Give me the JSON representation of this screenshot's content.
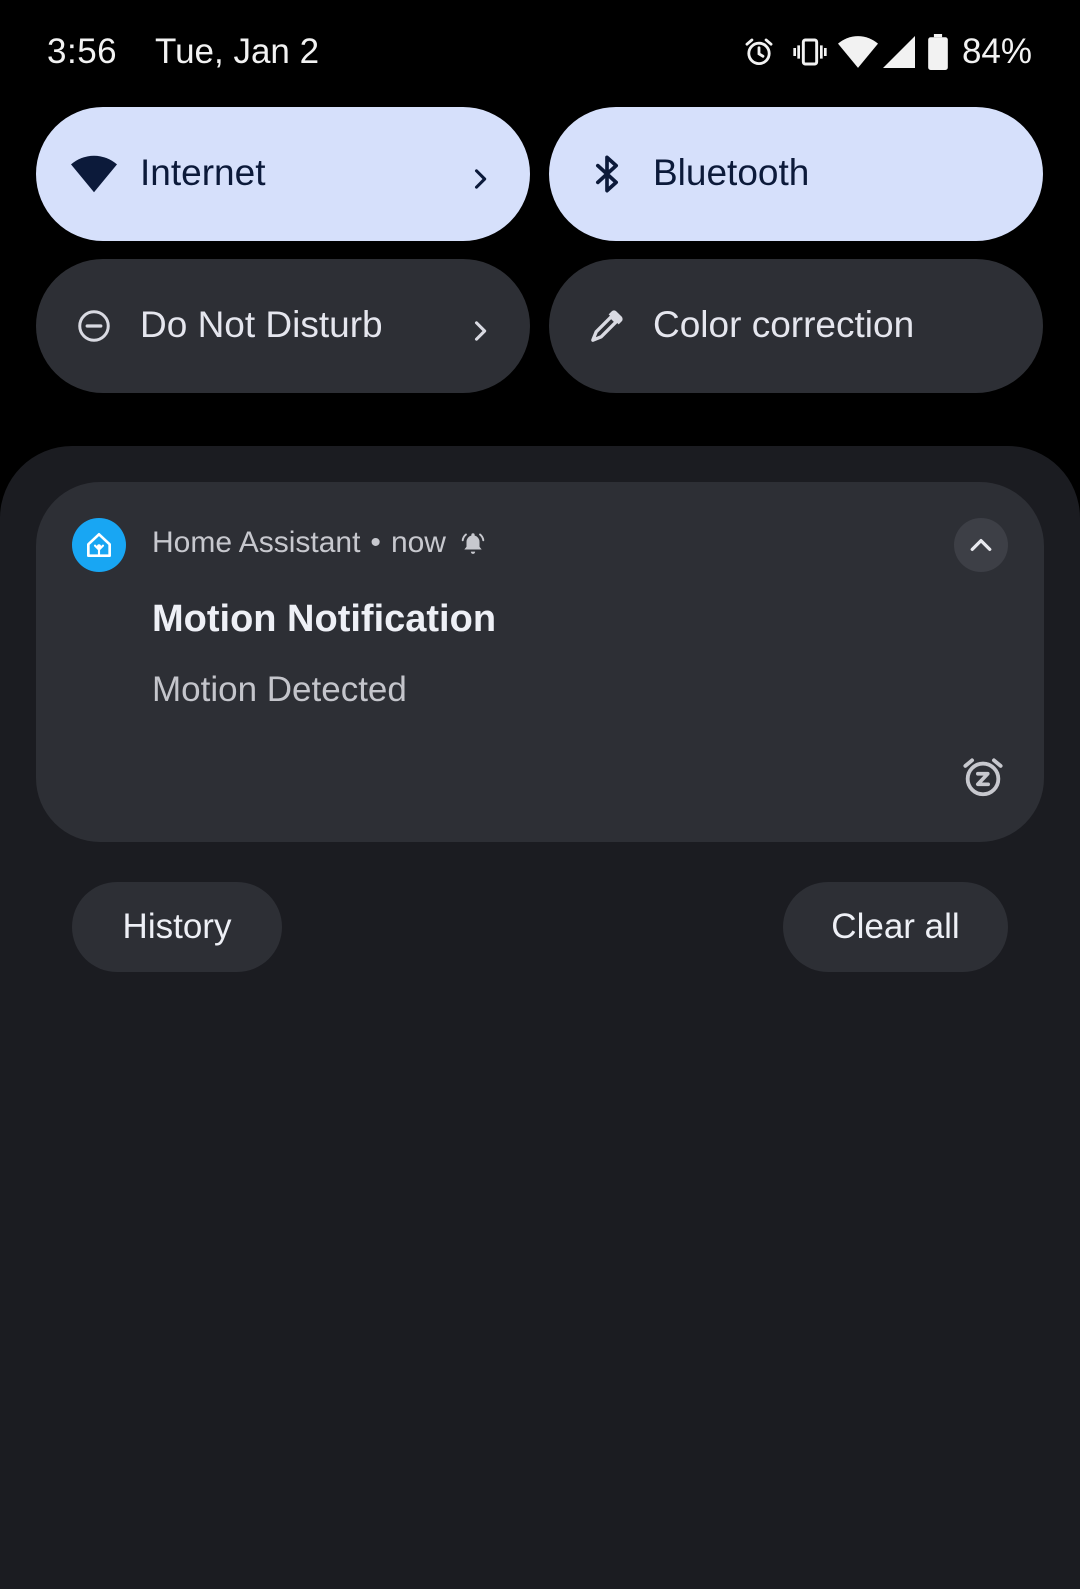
{
  "status_bar": {
    "time": "3:56",
    "date": "Tue, Jan 2",
    "icons": [
      "alarm-icon",
      "vibrate-icon",
      "wifi-icon",
      "cell-signal-icon",
      "battery-icon"
    ],
    "battery_percent": "84%"
  },
  "quick_settings": {
    "tiles": [
      {
        "label": "Internet",
        "icon": "wifi-icon",
        "state": "on",
        "has_chevron": true
      },
      {
        "label": "Bluetooth",
        "icon": "bluetooth-icon",
        "state": "on",
        "has_chevron": false
      },
      {
        "label": "Do Not Disturb",
        "icon": "do-not-disturb-icon",
        "state": "off",
        "has_chevron": true
      },
      {
        "label": "Color correction",
        "icon": "eyedropper-icon",
        "state": "off",
        "has_chevron": false
      }
    ],
    "colors": {
      "tile_on": "#d6e0fb",
      "tile_off": "#2d2f35"
    }
  },
  "notification": {
    "app_name": "Home Assistant",
    "separator": "•",
    "time": "now",
    "title": "Motion Notification",
    "text": "Motion Detected",
    "app_icon_color": "#18a6f3"
  },
  "actions": {
    "history": "History",
    "clear_all": "Clear all"
  }
}
